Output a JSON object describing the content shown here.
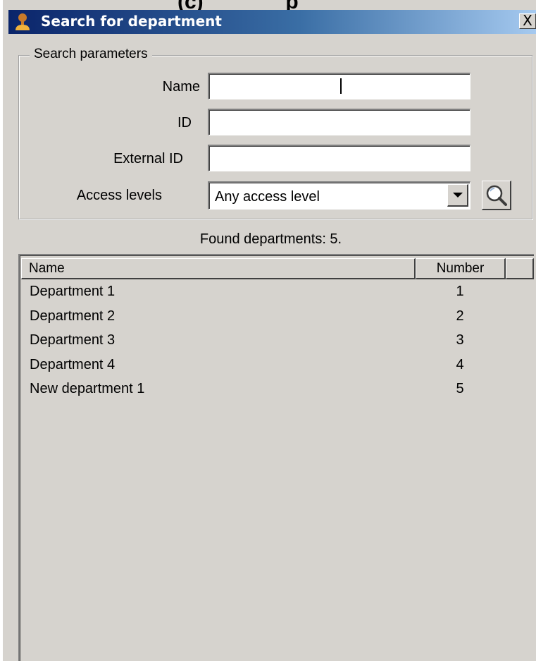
{
  "top_partial_text": "(c)              p",
  "window": {
    "title": "Search for department",
    "close_label": "X"
  },
  "search_params": {
    "legend": "Search parameters",
    "name_label": "Name",
    "name_value": "",
    "id_label": "ID",
    "id_value": "",
    "external_id_label": "External ID",
    "external_id_value": "",
    "access_levels_label": "Access levels",
    "access_levels_selected": "Any access level"
  },
  "results": {
    "found_text": "Found departments: 5.",
    "columns": [
      "Name",
      "Number"
    ],
    "rows": [
      {
        "name": "Department 1",
        "number": "1"
      },
      {
        "name": "Department 2",
        "number": "2"
      },
      {
        "name": "Department 3",
        "number": "3"
      },
      {
        "name": "Department 4",
        "number": "4"
      },
      {
        "name": "New department 1",
        "number": "5"
      }
    ]
  },
  "icons": {
    "title": "user-icon",
    "search": "magnifier-icon",
    "dropdown": "dropdown-arrow-icon"
  }
}
